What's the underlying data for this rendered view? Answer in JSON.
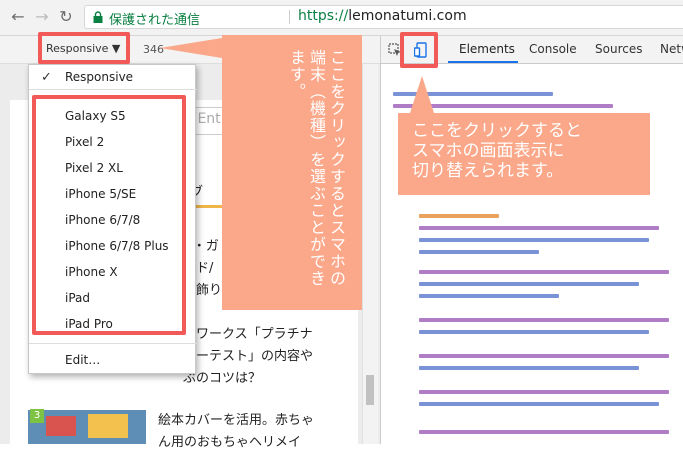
{
  "browser": {
    "secure_label": "保護された通信",
    "url_protocol": "https://",
    "url_host": "lemonatumi.com"
  },
  "device_toolbar": {
    "selected_device": "Responsive ▼",
    "width_value": "346"
  },
  "devtools": {
    "tabs": [
      "Elements",
      "Console",
      "Sources",
      "Netw"
    ],
    "active_tab": "Elements"
  },
  "device_menu": {
    "checked_item": "Responsive",
    "items": [
      "Galaxy S5",
      "Pixel 2",
      "Pixel 2 XL",
      "iPhone 5/SE",
      "iPhone 6/7/8",
      "iPhone 6/7/8 Plus",
      "iPhone X",
      "iPad",
      "iPad Pro"
    ],
    "edit_label": "Edit…"
  },
  "page": {
    "search_placeholder": "[Ent",
    "fragment_bu": "ブ",
    "article_1": [
      "N・ガ",
      "イド/",
      "表飾りしてみよう？"
    ],
    "article_2": [
      "ーワークス「プラチナ",
      "ターテスト」の内容や",
      "ぶのコツは？"
    ],
    "article_3_num": "3",
    "article_3": [
      "絵本カバーを活用。赤ちゃ",
      "ん用のおもちゃヘリメイ"
    ]
  },
  "annotations": {
    "vertical_callout": "ここをクリックするとスマホの端末（機種）を選ぶことができます。",
    "horizontal_callout": [
      "ここをクリックすると",
      "スマホの画面表示に",
      "切り替えられます。"
    ]
  },
  "colors": {
    "annotation_red": "#f25a57",
    "callout_orange": "#fba789",
    "secure_green": "#0b8043",
    "devtools_blue": "#1a73e8"
  }
}
